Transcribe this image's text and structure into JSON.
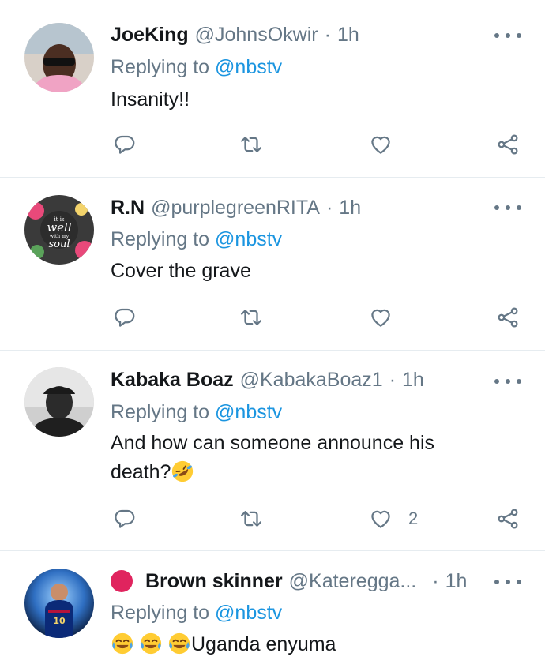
{
  "replying_label": "Replying to",
  "tweets": [
    {
      "name": "JoeKing",
      "handle": "@JohnsOkwir",
      "separator": "·",
      "time": "1h",
      "mention": "@nbstv",
      "text": "Insanity!!",
      "likes": ""
    },
    {
      "name": "R.N",
      "handle": "@purplegreenRITA",
      "separator": "·",
      "time": "1h",
      "mention": "@nbstv",
      "text": "Cover the grave",
      "likes": ""
    },
    {
      "name": "Kabaka Boaz",
      "handle": "@KabakaBoaz1",
      "separator": "·",
      "time": "1h",
      "mention": "@nbstv",
      "text": "And how can someone announce his death?",
      "likes": "2"
    },
    {
      "name": "Brown skinner",
      "handle": "@Kateregga...",
      "separator": "·",
      "time": "1h",
      "mention": "@nbstv",
      "text": "Uganda enyuma",
      "likes": ""
    }
  ],
  "avatar_text": {
    "line1": "it is",
    "line2": "well",
    "line3": "with my",
    "line4": "soul"
  },
  "jersey_number": "10",
  "icons": {
    "reply": "reply-icon",
    "retweet": "retweet-icon",
    "like": "heart-icon",
    "share": "share-icon",
    "more": "more-icon",
    "emoji_laugh_roll": "rolling-laughing-emoji",
    "emoji_tears": "tears-of-joy-emoji"
  },
  "colors": {
    "link": "#1b95e0",
    "secondary": "#657786",
    "status_dot": "#e0245e",
    "divider": "#e6ecf0"
  }
}
